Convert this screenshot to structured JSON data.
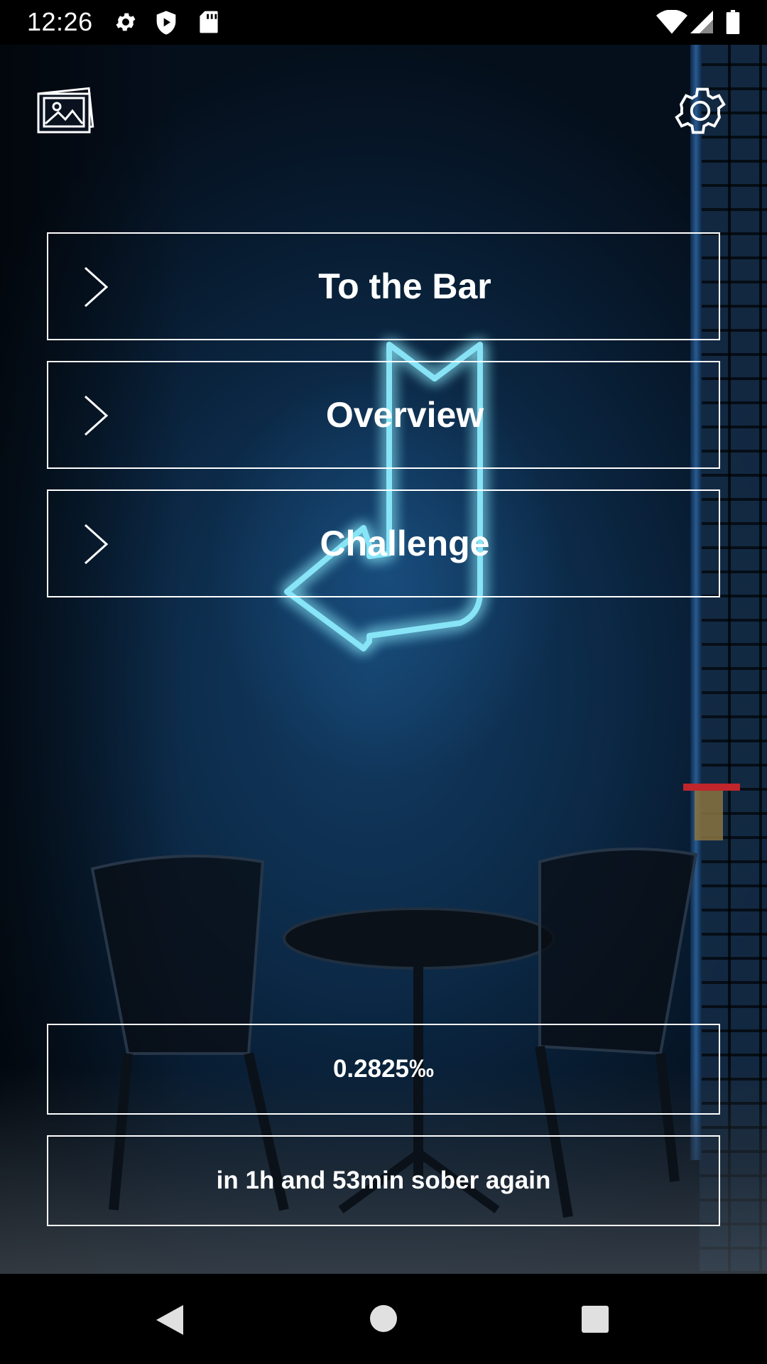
{
  "status_bar": {
    "time": "12:26",
    "icons": [
      "gear-icon",
      "shield-play-icon",
      "sd-card-icon",
      "wifi-icon",
      "signal-icon",
      "battery-icon"
    ]
  },
  "toolbar": {
    "gallery_icon": "gallery-icon",
    "settings_icon": "gear-icon"
  },
  "menu": {
    "items": [
      {
        "label": "To the Bar",
        "icon": "chevron-right-icon"
      },
      {
        "label": "Overview",
        "icon": "chevron-right-icon"
      },
      {
        "label": "Challenge",
        "icon": "chevron-right-icon"
      }
    ]
  },
  "info": {
    "bac": "0.2825‰",
    "sober_time": "in 1h and 53min sober again"
  },
  "nav_bar": {
    "icons": [
      "back-icon",
      "home-icon",
      "recents-icon"
    ]
  },
  "colors": {
    "accent_neon": "#7fe7ff",
    "background": "#0c2a48",
    "border": "#ffffff"
  }
}
